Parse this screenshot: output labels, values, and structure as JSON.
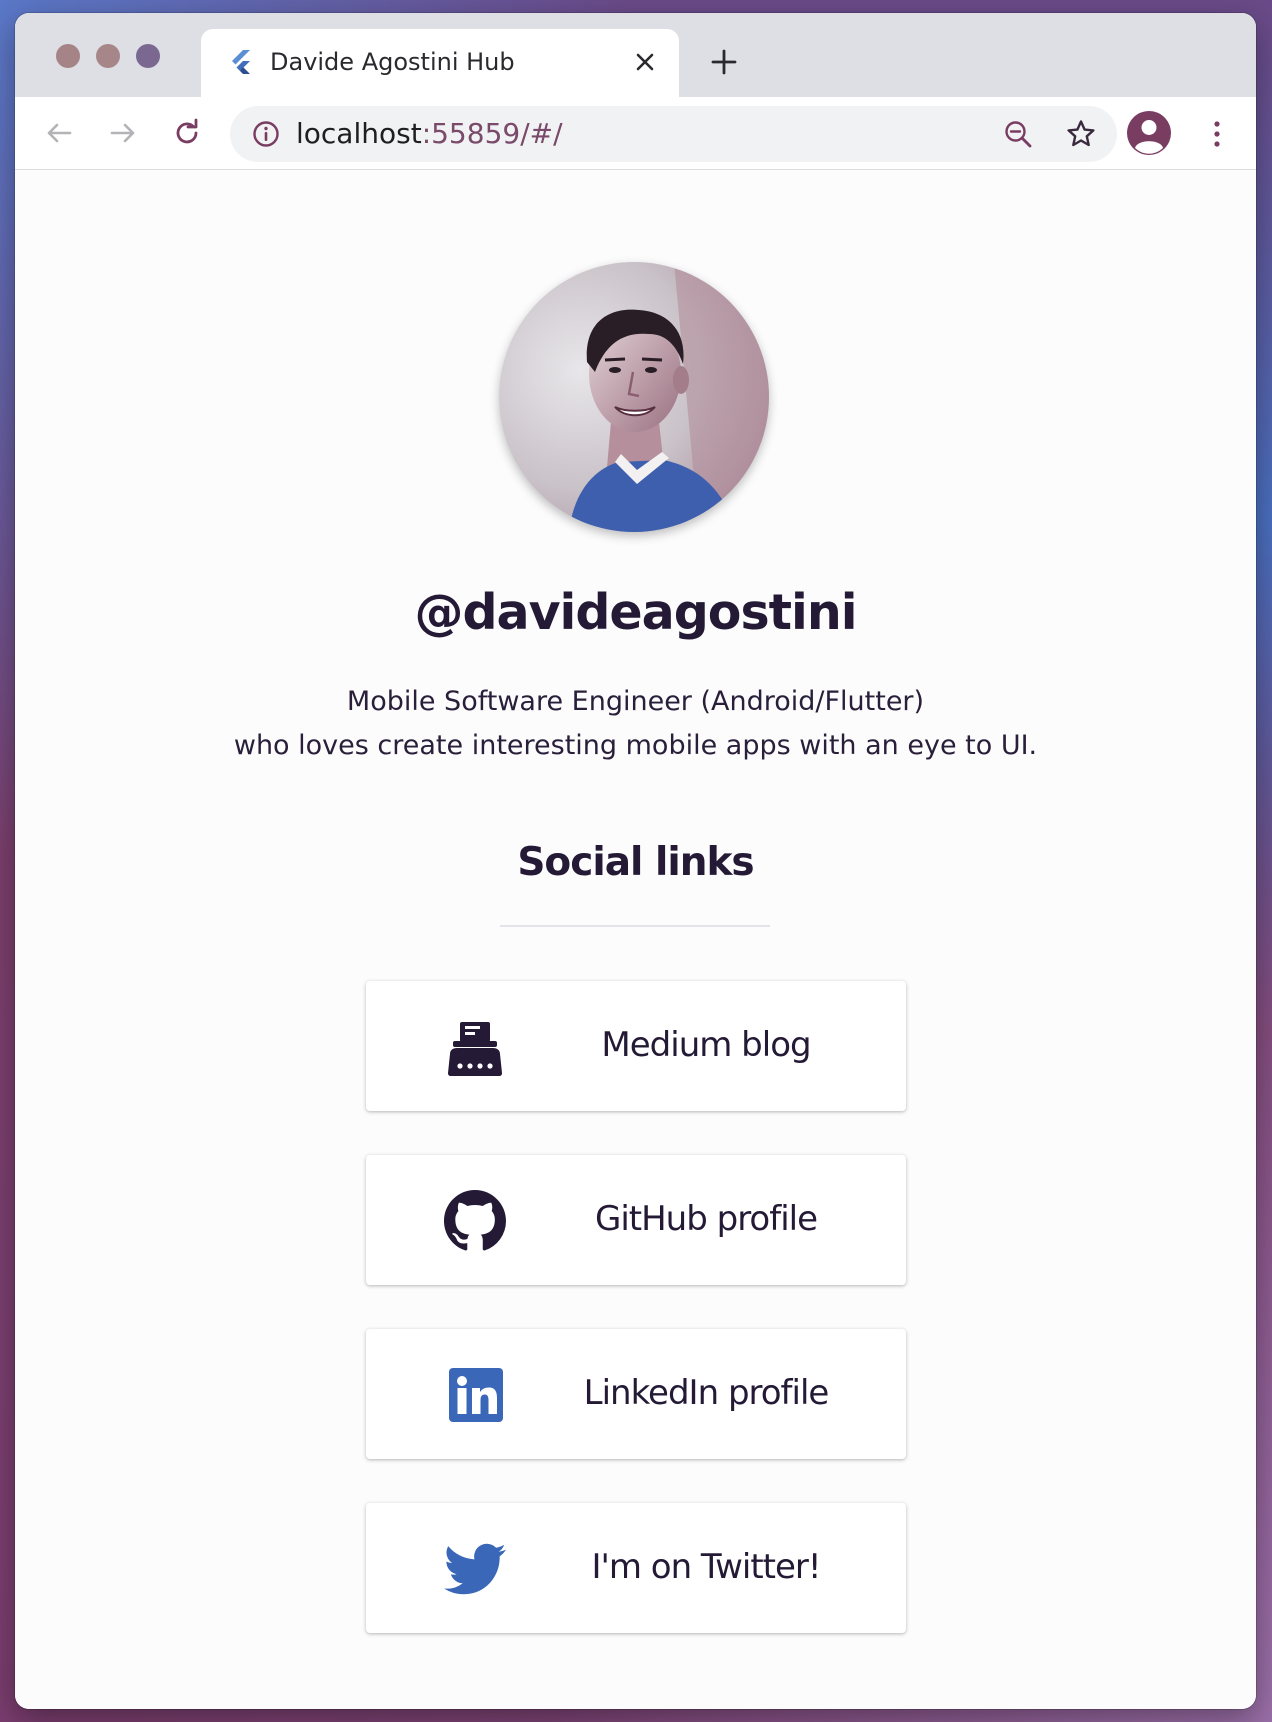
{
  "browser": {
    "tab": {
      "title": "Davide Agostini Hub"
    },
    "address": {
      "host": "localhost",
      "rest": ":55859/#/"
    }
  },
  "profile": {
    "handle": "@davideagostini",
    "bio_line1": "Mobile Software Engineer (Android/Flutter)",
    "bio_line2": "who loves create interesting mobile apps with an eye to UI."
  },
  "social": {
    "title": "Social links",
    "links": [
      {
        "label": "Medium blog",
        "icon": "typewriter-icon"
      },
      {
        "label": "GitHub profile",
        "icon": "github-icon"
      },
      {
        "label": "LinkedIn profile",
        "icon": "linkedin-icon"
      },
      {
        "label": "I'm on Twitter!",
        "icon": "twitter-icon"
      }
    ]
  },
  "colors": {
    "text_dark": "#241a36",
    "linkedin_blue": "#3a67b8",
    "twitter_blue": "#3a67b8",
    "accent_purple": "#7a3d62"
  }
}
